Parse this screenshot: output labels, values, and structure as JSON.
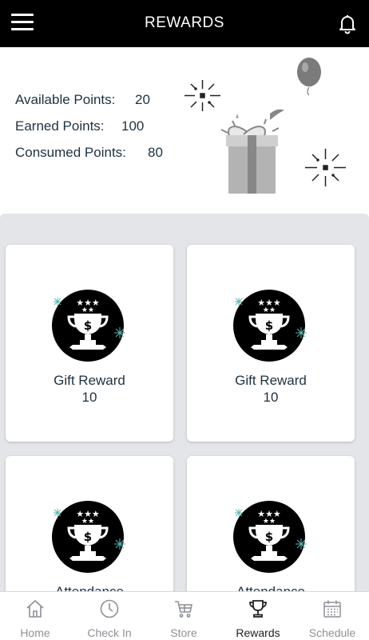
{
  "header": {
    "title": "REWARDS"
  },
  "points": {
    "available_label": "Available Points:",
    "available_value": "20",
    "earned_label": "Earned Points:",
    "earned_value": "100",
    "consumed_label": "Consumed Points:",
    "consumed_value": "80"
  },
  "rewards": [
    {
      "name": "Gift Reward",
      "points": "10"
    },
    {
      "name": "Gift Reward",
      "points": "10"
    },
    {
      "name": "Attendance",
      "points": ""
    },
    {
      "name": "Attendance",
      "points": ""
    }
  ],
  "nav": [
    {
      "label": "Home",
      "icon": "home-icon"
    },
    {
      "label": "Check In",
      "icon": "clock-icon"
    },
    {
      "label": "Store",
      "icon": "cart-icon"
    },
    {
      "label": "Rewards",
      "icon": "trophy-icon",
      "active": true
    },
    {
      "label": "Schedule",
      "icon": "calendar-icon"
    }
  ],
  "colors": {
    "header_bg": "#000000",
    "grid_bg": "#e4e5e8",
    "text": "#1f3140",
    "inactive_nav": "#8e9196"
  }
}
